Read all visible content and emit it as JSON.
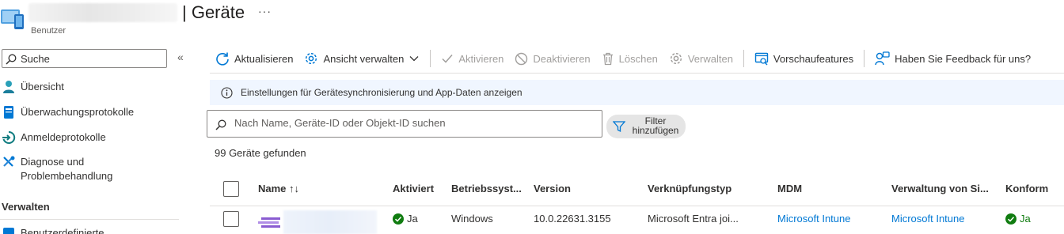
{
  "header": {
    "title": "| Geräte",
    "subtitle": "Benutzer",
    "more": "···"
  },
  "sidebar": {
    "search_value": "Suche",
    "collapse": "«",
    "items": [
      {
        "label": "Übersicht",
        "icon": "user-icon"
      },
      {
        "label": "Überwachungsprotokolle",
        "icon": "log-icon"
      },
      {
        "label": "Anmeldeprotokolle",
        "icon": "signin-icon"
      },
      {
        "label": "Diagnose und Problembehandlung",
        "icon": "wrench-icon"
      }
    ],
    "section": "Verwalten",
    "partial_item": "Benutzerdefinierte"
  },
  "toolbar": {
    "refresh": "Aktualisieren",
    "view_manage": "Ansicht verwalten",
    "activate": "Aktivieren",
    "deactivate": "Deaktivieren",
    "delete": "Löschen",
    "manage": "Verwalten",
    "preview": "Vorschaufeatures",
    "feedback": "Haben Sie Feedback für uns?"
  },
  "info": {
    "text": "Einstellungen für Gerätesynchronisierung und App-Daten anzeigen"
  },
  "search": {
    "placeholder": "Nach Name, Geräte-ID oder Objekt-ID suchen"
  },
  "filter": {
    "label": "Filter hinzufügen"
  },
  "count": "99 Geräte gefunden",
  "table": {
    "columns": {
      "name": "Name ↑↓",
      "enabled": "Aktiviert",
      "os": "Betriebssyst...",
      "version": "Version",
      "join_type": "Verknüpfungstyp",
      "mdm": "MDM",
      "managed_by": "Verwaltung von Si...",
      "compliant": "Konform"
    },
    "rows": [
      {
        "enabled": "Ja",
        "os": "Windows",
        "version": "10.0.22631.3155",
        "join_type": "Microsoft Entra joi...",
        "mdm": "Microsoft Intune",
        "managed_by": "Microsoft Intune",
        "compliant": "Ja"
      }
    ]
  },
  "colors": {
    "accent": "#0078d4",
    "success": "#107c10",
    "disabled": "#a19f9d",
    "info_bg": "#f0f6ff"
  }
}
